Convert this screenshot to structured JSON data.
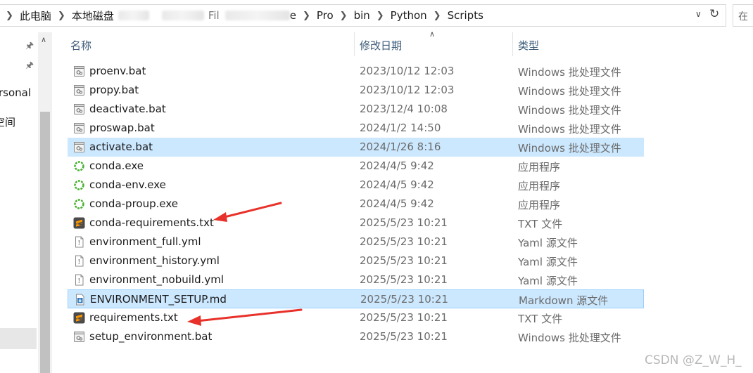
{
  "address_bar": {
    "crumbs": [
      "此电脑",
      "本地磁盘",
      "Pro",
      "bin",
      "Python",
      "Scripts"
    ],
    "partial_crumb_1": "Fil",
    "partial_crumb_2": "e",
    "search_placeholder": "在"
  },
  "nav": {
    "items": [
      {
        "label": "rsonal"
      },
      {
        "label": "空间"
      }
    ]
  },
  "columns": {
    "name": "名称",
    "modified": "修改日期",
    "type": "类型"
  },
  "files": [
    {
      "name": "proenv.bat",
      "modified": "2023/10/12 12:03",
      "type": "Windows 批处理文件",
      "icon": "bat-icon",
      "selected": false
    },
    {
      "name": "propy.bat",
      "modified": "2023/10/12 12:03",
      "type": "Windows 批处理文件",
      "icon": "bat-icon",
      "selected": false
    },
    {
      "name": "deactivate.bat",
      "modified": "2023/12/4 10:08",
      "type": "Windows 批处理文件",
      "icon": "bat-icon",
      "selected": false
    },
    {
      "name": "proswap.bat",
      "modified": "2024/1/2 14:50",
      "type": "Windows 批处理文件",
      "icon": "bat-icon",
      "selected": false
    },
    {
      "name": "activate.bat",
      "modified": "2024/1/26 8:16",
      "type": "Windows 批处理文件",
      "icon": "bat-icon",
      "selected": true
    },
    {
      "name": "conda.exe",
      "modified": "2024/4/5 9:42",
      "type": "应用程序",
      "icon": "conda-icon",
      "selected": false
    },
    {
      "name": "conda-env.exe",
      "modified": "2024/4/5 9:42",
      "type": "应用程序",
      "icon": "conda-icon",
      "selected": false
    },
    {
      "name": "conda-proup.exe",
      "modified": "2024/4/5 9:42",
      "type": "应用程序",
      "icon": "conda-icon",
      "selected": false
    },
    {
      "name": "conda-requirements.txt",
      "modified": "2025/5/23 10:21",
      "type": "TXT 文件",
      "icon": "sublime-icon",
      "selected": false
    },
    {
      "name": "environment_full.yml",
      "modified": "2025/5/23 10:21",
      "type": "Yaml 源文件",
      "icon": "yaml-icon",
      "selected": false
    },
    {
      "name": "environment_history.yml",
      "modified": "2025/5/23 10:21",
      "type": "Yaml 源文件",
      "icon": "yaml-icon",
      "selected": false
    },
    {
      "name": "environment_nobuild.yml",
      "modified": "2025/5/23 10:21",
      "type": "Yaml 源文件",
      "icon": "yaml-icon",
      "selected": false
    },
    {
      "name": "ENVIRONMENT_SETUP.md",
      "modified": "2025/5/23 10:21",
      "type": "Markdown 源文件",
      "icon": "markdown-icon",
      "selected": true
    },
    {
      "name": "requirements.txt",
      "modified": "2025/5/23 10:21",
      "type": "TXT 文件",
      "icon": "sublime-icon",
      "selected": false
    },
    {
      "name": "setup_environment.bat",
      "modified": "2025/5/23 10:21",
      "type": "Windows 批处理文件",
      "icon": "bat-icon",
      "selected": false
    }
  ],
  "watermark": "CSDN @Z_W_H_",
  "colors": {
    "selection": "#cce8ff",
    "arrow": "#e8312a",
    "header_text": "#3b5a78"
  }
}
